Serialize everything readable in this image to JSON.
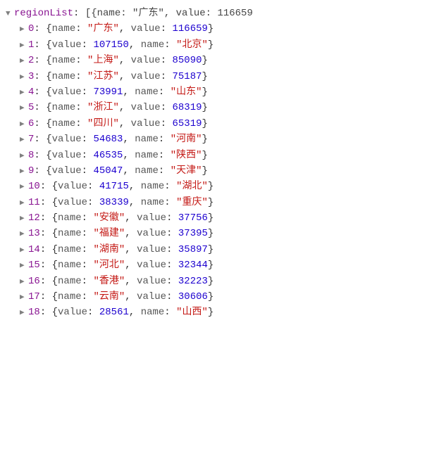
{
  "rootKey": "regionList",
  "previewText": "[{name: \"广东\", value: 116659",
  "items": [
    {
      "index": "0",
      "order": "nv",
      "name": "广东",
      "value": "116659"
    },
    {
      "index": "1",
      "order": "vn",
      "name": "北京",
      "value": "107150"
    },
    {
      "index": "2",
      "order": "nv",
      "name": "上海",
      "value": "85090"
    },
    {
      "index": "3",
      "order": "nv",
      "name": "江苏",
      "value": "75187"
    },
    {
      "index": "4",
      "order": "vn",
      "name": "山东",
      "value": "73991"
    },
    {
      "index": "5",
      "order": "nv",
      "name": "浙江",
      "value": "68319"
    },
    {
      "index": "6",
      "order": "nv",
      "name": "四川",
      "value": "65319"
    },
    {
      "index": "7",
      "order": "vn",
      "name": "河南",
      "value": "54683"
    },
    {
      "index": "8",
      "order": "vn",
      "name": "陕西",
      "value": "46535"
    },
    {
      "index": "9",
      "order": "vn",
      "name": "天津",
      "value": "45047"
    },
    {
      "index": "10",
      "order": "vn",
      "name": "湖北",
      "value": "41715"
    },
    {
      "index": "11",
      "order": "vn",
      "name": "重庆",
      "value": "38339"
    },
    {
      "index": "12",
      "order": "nv",
      "name": "安徽",
      "value": "37756"
    },
    {
      "index": "13",
      "order": "nv",
      "name": "福建",
      "value": "37395"
    },
    {
      "index": "14",
      "order": "nv",
      "name": "湖南",
      "value": "35897"
    },
    {
      "index": "15",
      "order": "nv",
      "name": "河北",
      "value": "32344"
    },
    {
      "index": "16",
      "order": "nv",
      "name": "香港",
      "value": "32223"
    },
    {
      "index": "17",
      "order": "nv",
      "name": "云南",
      "value": "30606"
    },
    {
      "index": "18",
      "order": "vn",
      "name": "山西",
      "value": "28561"
    }
  ]
}
